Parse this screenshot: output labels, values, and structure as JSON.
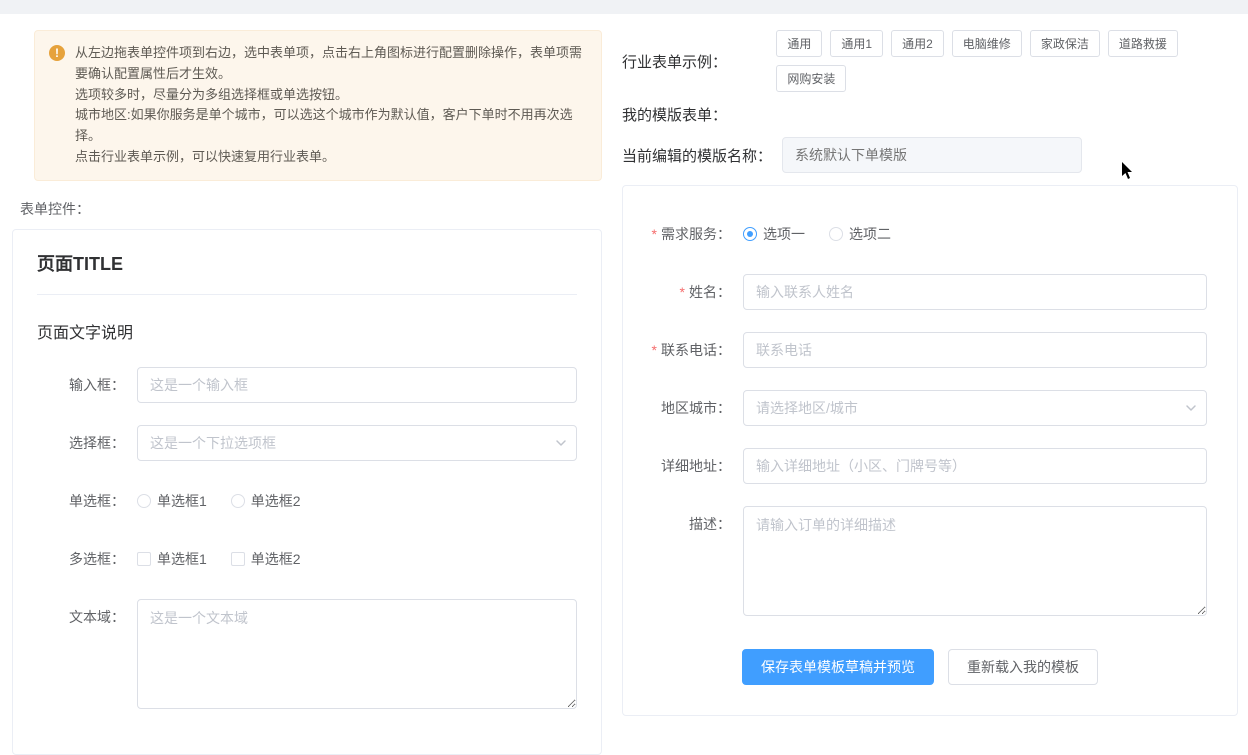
{
  "alert": {
    "line1": "从左边拖表单控件项到右边，选中表单项，点击右上角图标进行配置删除操作，表单项需要确认配置属性后才生效。",
    "line2": "选项较多时，尽量分为多组选择框或单选按钮。",
    "line3": "城市地区:如果你服务是单个城市，可以选这个城市作为默认值，客户下单时不用再次选择。",
    "line4": "点击行业表单示例，可以快速复用行业表单。"
  },
  "left": {
    "controls_label": "表单控件：",
    "page_title": "页面TITLE",
    "page_desc": "页面文字说明",
    "fields": {
      "input_label": "输入框：",
      "input_ph": "这是一个输入框",
      "select_label": "选择框：",
      "select_ph": "这是一个下拉选项框",
      "radio_label": "单选框：",
      "radio_opt1": "单选框1",
      "radio_opt2": "单选框2",
      "check_label": "多选框：",
      "check_opt1": "单选框1",
      "check_opt2": "单选框2",
      "textarea_label": "文本域：",
      "textarea_ph": "这是一个文本域"
    }
  },
  "right": {
    "industry_label": "行业表单示例：",
    "industry_tags": {
      "t0": "通用",
      "t1": "通用1",
      "t2": "通用2",
      "t3": "电脑维修",
      "t4": "家政保洁",
      "t5": "道路救援",
      "t6": "网购安装"
    },
    "my_templates_label": "我的模版表单：",
    "current_tpl_label": "当前编辑的模版名称：",
    "current_tpl_ph": "系统默认下单模版",
    "form": {
      "service_label": "需求服务：",
      "service_opt1": "选项一",
      "service_opt2": "选项二",
      "name_label": "姓名：",
      "name_ph": "输入联系人姓名",
      "phone_label": "联系电话：",
      "phone_ph": "联系电话",
      "city_label": "地区城市：",
      "city_ph": "请选择地区/城市",
      "addr_label": "详细地址：",
      "addr_ph": "输入详细地址（小区、门牌号等）",
      "desc_label": "描述：",
      "desc_ph": "请输入订单的详细描述"
    },
    "buttons": {
      "save": "保存表单模板草稿并预览",
      "reload": "重新载入我的模板"
    }
  }
}
